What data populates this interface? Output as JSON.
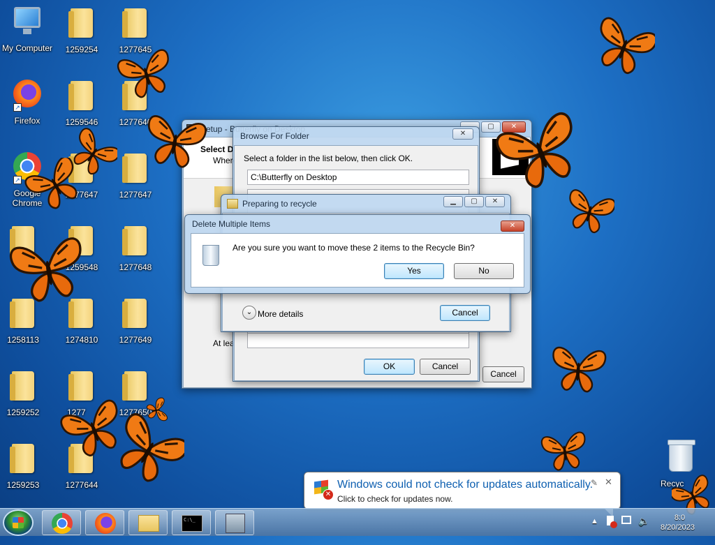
{
  "desktop_icons": [
    {
      "label": "My Computer",
      "icon": "computer-icon"
    },
    {
      "label": "1259254",
      "icon": "folder-icon"
    },
    {
      "label": "1277645",
      "icon": "folder-icon"
    },
    {
      "label": "Firefox",
      "icon": "firefox-icon"
    },
    {
      "label": "1259546",
      "icon": "folder-icon"
    },
    {
      "label": "1277646",
      "icon": "folder-icon"
    },
    {
      "label": "Google Chrome",
      "icon": "chrome-icon"
    },
    {
      "label": "1277647",
      "icon": "folder-icon"
    },
    {
      "label": "1277647",
      "icon": "folder-icon"
    },
    {
      "label": "1277648",
      "icon": "folder-icon"
    },
    {
      "label": "1259548",
      "icon": "folder-icon"
    },
    {
      "label": "1277648",
      "icon": "folder-icon"
    },
    {
      "label": "1258113",
      "icon": "folder-icon"
    },
    {
      "label": "1274810",
      "icon": "folder-icon"
    },
    {
      "label": "1277649",
      "icon": "folder-icon"
    },
    {
      "label": "1259252",
      "icon": "folder-icon"
    },
    {
      "label": "1277",
      "icon": "folder-icon"
    },
    {
      "label": "1277650",
      "icon": "folder-icon"
    },
    {
      "label": "1259253",
      "icon": "folder-icon"
    },
    {
      "label": "1277644",
      "icon": "folder-icon"
    },
    {
      "label": "Recyc",
      "icon": "recycle-bin-icon"
    }
  ],
  "setup_window": {
    "title": "Setup - Butterfly on Desktop",
    "heading": "Select D",
    "subheading": "Where",
    "footer_text": "At leas",
    "cancel_label": "Cancel"
  },
  "browse_dialog": {
    "title": "Browse For Folder",
    "instruction": "Select a folder in the list below, then click OK.",
    "path_value": "C:\\Butterfly on Desktop",
    "ok_label": "OK",
    "cancel_label": "Cancel"
  },
  "recycle_dialog": {
    "title": "Preparing to recycle",
    "more_details_label": "More details",
    "cancel_label": "Cancel"
  },
  "delete_dialog": {
    "title": "Delete Multiple Items",
    "message": "Are you sure you want to move these 2 items to the Recycle Bin?",
    "yes_label": "Yes",
    "no_label": "No"
  },
  "notification": {
    "title": "Windows could not check for updates automatically.",
    "body": "Click to check for updates now."
  },
  "taskbar": {
    "items": [
      "internet-explorer-icon",
      "chrome-icon",
      "firefox-icon",
      "file-explorer-icon",
      "command-prompt-icon",
      "setup-installer-icon"
    ],
    "clock_time": "8:0",
    "clock_date": "8/20/2023"
  },
  "colors": {
    "accent_blue": "#1e6fc5",
    "notification_title": "#0d5fb0",
    "butterfly_orange": "#f07a14"
  }
}
